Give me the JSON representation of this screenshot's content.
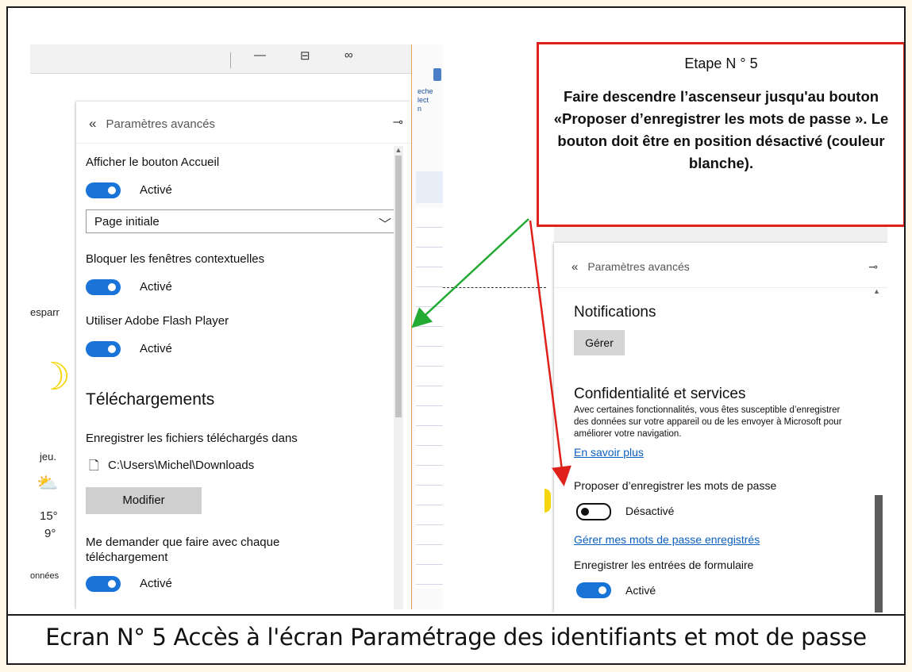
{
  "callout": {
    "title": "Etape N ° 5",
    "body": "Faire descendre l’ascenseur jusqu'au bouton «Proposer d’enregistrer les mots de passe ». Le bouton doit être en position désactivé (couleur blanche)."
  },
  "caption": "Ecran N° 5 Accès à l'écran Paramétrage des identifiants et mot de passe",
  "left_panel": {
    "header": "Paramètres avancés",
    "back_chevron": "«",
    "pin_icon": "pin-icon",
    "home_button": {
      "label": "Afficher le bouton Accueil",
      "toggle": "Activé"
    },
    "home_select": {
      "value": "Page initiale"
    },
    "popups": {
      "label": "Bloquer les fenêtres contextuelles",
      "toggle": "Activé"
    },
    "flash": {
      "label": "Utiliser Adobe Flash Player",
      "toggle": "Activé"
    },
    "downloads_heading": "Téléchargements",
    "save_location_label": "Enregistrer les fichiers téléchargés dans",
    "save_path": "C:\\Users\\Michel\\Downloads",
    "modify_button": "Modifier",
    "ask_label": "Me demander que faire avec chaque téléchargement",
    "ask_toggle": "Activé"
  },
  "left_background": {
    "side_text_1": "esparr",
    "day": "jeu.",
    "temp_high": "15°",
    "temp_low": "9°",
    "side_text_2": "onnées",
    "office_text": "eche\nlect\nn"
  },
  "right_panel": {
    "header": "Paramètres avancés",
    "back_chevron": "«",
    "notifications_heading": "Notifications",
    "manage_button": "Gérer",
    "privacy_heading": "Confidentialité et services",
    "privacy_desc": "Avec certaines fonctionnalités, vous êtes susceptible d’enregistrer des données sur votre appareil ou de les envoyer à Microsoft pour améliorer votre navigation.",
    "learn_more": "En savoir plus",
    "offer_save_label": "Proposer d’enregistrer les mots de passe",
    "offer_save_toggle": "Désactivé",
    "manage_passwords_link": "Gérer mes mots de passe enregistrés",
    "form_entries_label": "Enregistrer les entrées de formulaire",
    "form_entries_toggle": "Activé"
  },
  "colors": {
    "toggle_on": "#1a73d6",
    "callout_border": "#e0201a",
    "green_arrow": "#22aa33",
    "red_arrow": "#e0201a"
  }
}
